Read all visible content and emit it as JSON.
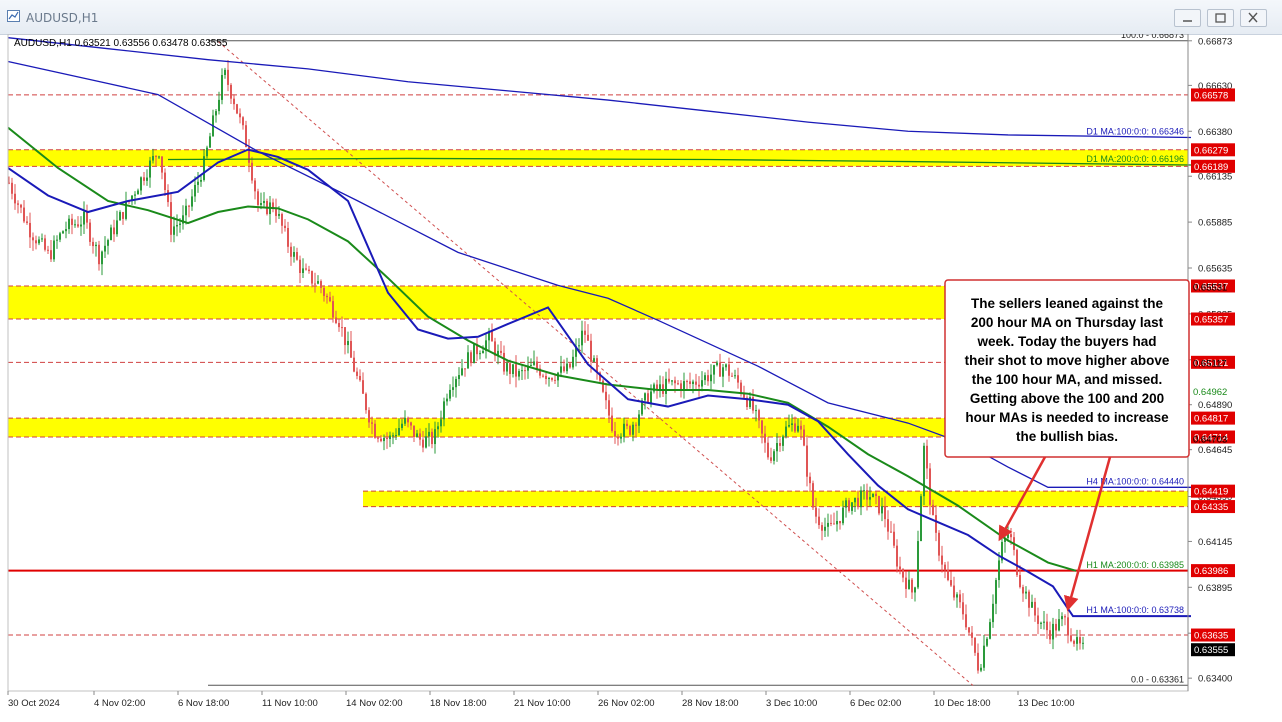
{
  "window": {
    "title": "AUDUSD,H1",
    "buttons": [
      "minimize",
      "restore",
      "close"
    ]
  },
  "chart_data": {
    "type": "candlestick",
    "symbol_info": "AUDUSD,H1  0.63521 0.63556 0.63478 0.63555",
    "ylim": [
      0.6333,
      0.6691
    ],
    "price_ticks": [
      "0.66873",
      "0.66630",
      "0.66380",
      "0.66135",
      "0.65885",
      "0.65635",
      "0.65385",
      "0.65135",
      "0.64890",
      "0.64645",
      "0.64390",
      "0.64145",
      "0.63895",
      "0.63645",
      "0.63400"
    ],
    "x_ticks": [
      "30 Oct 2024",
      "4 Nov 02:00",
      "6 Nov 18:00",
      "11 Nov 10:00",
      "14 Nov 02:00",
      "18 Nov 18:00",
      "21 Nov 10:00",
      "26 Nov 02:00",
      "28 Nov 18:00",
      "3 Dec 10:00",
      "6 Dec 02:00",
      "10 Dec 18:00",
      "13 Dec 10:00"
    ],
    "zones": [
      {
        "top": 0.66279,
        "bottom": 0.66189,
        "top_label": "0.66279",
        "bottom_label": "0.66189"
      },
      {
        "top": 0.65537,
        "bottom": 0.65357,
        "top_label": "0.65537",
        "bottom_label": "0.65357"
      },
      {
        "top": 0.64817,
        "bottom": 0.64714,
        "top_label": "0.64817",
        "bottom_label": "0.64714"
      },
      {
        "top": 0.64419,
        "bottom": 0.64335,
        "top_label": "0.64419",
        "bottom_label": "0.64335"
      }
    ],
    "red_labels": [
      "0.66578",
      "0.65121",
      "0.63986",
      "0.63635"
    ],
    "current_price": "0.63555",
    "fib": {
      "top_label": "100.0 - 0.66873",
      "bottom_label": "0.0 - 0.63361"
    },
    "ma_labels": [
      {
        "text": "D1 MA:100:0:0: 0.66346",
        "color": "#1a1ab8"
      },
      {
        "text": "D1 MA:200:0:0: 0.66196",
        "color": "#1a8a1a"
      },
      {
        "text": "H4 MA:100:0:0: 0.64440",
        "color": "#1a1ab8"
      },
      {
        "text": "H1 MA:200:0:0: 0.63985",
        "color": "#1a8a1a"
      },
      {
        "text": "H1 MA:100:0:0: 0.63738",
        "color": "#1a1ab8"
      }
    ],
    "axis_ma_values": [
      {
        "text": "0.65531",
        "color": "#000000"
      },
      {
        "text": "0.65117",
        "color": "#000000"
      },
      {
        "text": "0.64962",
        "color": "#1a8a1a"
      },
      {
        "text": "0.64703",
        "color": "#000000"
      }
    ],
    "annotation": "The sellers leaned against the 200 hour MA on Thursday last week. Today the buyers had their shot to move higher above the 100 hour MA, and missed. Getting above the 100 and 200 hour MAs is needed to increase the bullish bias.",
    "series": [
      {
        "name": "D1 MA:100",
        "color": "#1a1ab8",
        "points": [
          [
            0,
            0.6689
          ],
          [
            100,
            0.6683
          ],
          [
            200,
            0.6677
          ],
          [
            300,
            0.6672
          ],
          [
            400,
            0.6665
          ],
          [
            500,
            0.666
          ],
          [
            600,
            0.6655
          ],
          [
            700,
            0.6649
          ],
          [
            800,
            0.6643
          ],
          [
            900,
            0.6638
          ],
          [
            1000,
            0.6636
          ],
          [
            1183,
            0.66346
          ]
        ]
      },
      {
        "name": "D1 MA:200",
        "color": "#1a8a1a",
        "points": [
          [
            160,
            0.66226
          ],
          [
            400,
            0.66232
          ],
          [
            700,
            0.66226
          ],
          [
            900,
            0.66215
          ],
          [
            1183,
            0.66196
          ]
        ]
      },
      {
        "name": "H4 MA:100",
        "color": "#1a1ab8",
        "points": [
          [
            0,
            0.6676
          ],
          [
            100,
            0.6664
          ],
          [
            150,
            0.6658
          ],
          [
            250,
            0.6627
          ],
          [
            350,
            0.66
          ],
          [
            450,
            0.6572
          ],
          [
            550,
            0.6554
          ],
          [
            600,
            0.6547
          ],
          [
            650,
            0.6535
          ],
          [
            750,
            0.651
          ],
          [
            820,
            0.649
          ],
          [
            900,
            0.6479
          ],
          [
            960,
            0.6467
          ],
          [
            1000,
            0.6455
          ],
          [
            1040,
            0.6444
          ],
          [
            1183,
            0.6444
          ]
        ]
      },
      {
        "name": "H1 MA:200",
        "color": "#1a8a1a",
        "points": [
          [
            0,
            0.664
          ],
          [
            50,
            0.6618
          ],
          [
            100,
            0.66
          ],
          [
            140,
            0.6595
          ],
          [
            180,
            0.6588
          ],
          [
            210,
            0.6594
          ],
          [
            240,
            0.6597
          ],
          [
            270,
            0.6596
          ],
          [
            300,
            0.659
          ],
          [
            340,
            0.6578
          ],
          [
            380,
            0.6558
          ],
          [
            420,
            0.6537
          ],
          [
            460,
            0.6524
          ],
          [
            500,
            0.6513
          ],
          [
            550,
            0.6505
          ],
          [
            600,
            0.65
          ],
          [
            650,
            0.6497
          ],
          [
            700,
            0.6497
          ],
          [
            740,
            0.6495
          ],
          [
            780,
            0.649
          ],
          [
            820,
            0.6477
          ],
          [
            860,
            0.6462
          ],
          [
            900,
            0.645
          ],
          [
            950,
            0.6434
          ],
          [
            1000,
            0.6415
          ],
          [
            1040,
            0.6403
          ],
          [
            1068,
            0.63985
          ]
        ]
      },
      {
        "name": "H1 MA:100",
        "color": "#1a1ab8",
        "points": [
          [
            0,
            0.6618
          ],
          [
            40,
            0.6603
          ],
          [
            80,
            0.6594
          ],
          [
            120,
            0.66
          ],
          [
            170,
            0.6605
          ],
          [
            210,
            0.6621
          ],
          [
            240,
            0.6628
          ],
          [
            270,
            0.6624
          ],
          [
            300,
            0.6617
          ],
          [
            340,
            0.66
          ],
          [
            380,
            0.655
          ],
          [
            410,
            0.653
          ],
          [
            440,
            0.6525
          ],
          [
            470,
            0.6526
          ],
          [
            500,
            0.6533
          ],
          [
            540,
            0.6542
          ],
          [
            580,
            0.6511
          ],
          [
            620,
            0.6492
          ],
          [
            660,
            0.6488
          ],
          [
            700,
            0.6494
          ],
          [
            740,
            0.6492
          ],
          [
            780,
            0.6489
          ],
          [
            810,
            0.648
          ],
          [
            840,
            0.6462
          ],
          [
            870,
            0.6445
          ],
          [
            900,
            0.6432
          ],
          [
            930,
            0.6425
          ],
          [
            960,
            0.6418
          ],
          [
            990,
            0.6407
          ],
          [
            1020,
            0.6398
          ],
          [
            1045,
            0.639
          ],
          [
            1065,
            0.63738
          ],
          [
            1183,
            0.63738
          ]
        ]
      }
    ],
    "candle_path": [
      [
        0,
        0.661
      ],
      [
        20,
        0.6585
      ],
      [
        40,
        0.657
      ],
      [
        55,
        0.6585
      ],
      [
        75,
        0.659
      ],
      [
        90,
        0.657
      ],
      [
        110,
        0.659
      ],
      [
        130,
        0.661
      ],
      [
        150,
        0.6628
      ],
      [
        162,
        0.6585
      ],
      [
        175,
        0.659
      ],
      [
        195,
        0.662
      ],
      [
        205,
        0.6645
      ],
      [
        215,
        0.667
      ],
      [
        225,
        0.6655
      ],
      [
        238,
        0.663
      ],
      [
        250,
        0.6595
      ],
      [
        265,
        0.6598
      ],
      [
        280,
        0.6575
      ],
      [
        295,
        0.656
      ],
      [
        310,
        0.6555
      ],
      [
        330,
        0.6535
      ],
      [
        350,
        0.65
      ],
      [
        365,
        0.6475
      ],
      [
        380,
        0.647
      ],
      [
        395,
        0.648
      ],
      [
        410,
        0.647
      ],
      [
        425,
        0.647
      ],
      [
        440,
        0.65
      ],
      [
        460,
        0.6515
      ],
      [
        480,
        0.6525
      ],
      [
        495,
        0.651
      ],
      [
        510,
        0.6505
      ],
      [
        525,
        0.651
      ],
      [
        540,
        0.6505
      ],
      [
        560,
        0.6508
      ],
      [
        575,
        0.653
      ],
      [
        590,
        0.65
      ],
      [
        605,
        0.6475
      ],
      [
        620,
        0.6475
      ],
      [
        640,
        0.6495
      ],
      [
        660,
        0.65
      ],
      [
        680,
        0.65
      ],
      [
        700,
        0.6505
      ],
      [
        715,
        0.651
      ],
      [
        730,
        0.65
      ],
      [
        745,
        0.6485
      ],
      [
        760,
        0.646
      ],
      [
        775,
        0.6475
      ],
      [
        790,
        0.648
      ],
      [
        805,
        0.643
      ],
      [
        820,
        0.642
      ],
      [
        840,
        0.6435
      ],
      [
        860,
        0.644
      ],
      [
        875,
        0.643
      ],
      [
        890,
        0.64
      ],
      [
        905,
        0.6385
      ],
      [
        915,
        0.6465
      ],
      [
        925,
        0.642
      ],
      [
        940,
        0.639
      ],
      [
        955,
        0.6375
      ],
      [
        970,
        0.6345
      ],
      [
        980,
        0.637
      ],
      [
        992,
        0.641
      ],
      [
        1000,
        0.642
      ],
      [
        1010,
        0.6395
      ],
      [
        1025,
        0.6375
      ],
      [
        1040,
        0.6365
      ],
      [
        1055,
        0.6372
      ],
      [
        1068,
        0.6358
      ],
      [
        1075,
        0.6355
      ]
    ]
  }
}
